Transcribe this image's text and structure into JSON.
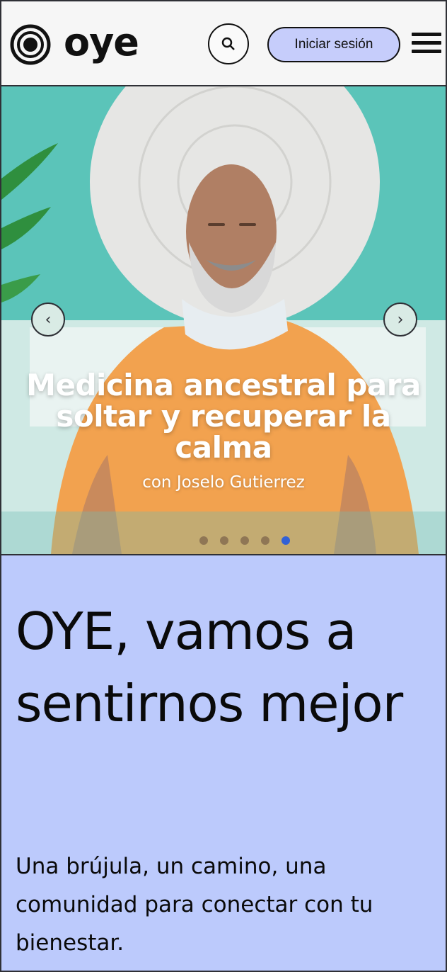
{
  "header": {
    "logo_text": "oye",
    "login_label": "Iniciar sesión",
    "icons": {
      "logo": "concentric-circle-logo",
      "search": "search-icon",
      "menu": "hamburger-menu-icon"
    }
  },
  "hero": {
    "title": "Medicina ancestral para soltar y recuperar la calma",
    "subtitle": "con Joselo Gutierrez",
    "prev_icon": "‹",
    "next_icon": "›",
    "slide_count": 5,
    "active_slide": 5,
    "colors": {
      "background": "#5bc4b9",
      "shirt": "#f2a24f",
      "active_dot": "#3261d6"
    }
  },
  "intro": {
    "headline": "OYE, vamos a sentirnos mejor",
    "tagline": "Una brújula, un camino, una comunidad para conectar con tu bienestar.",
    "background": "#bccafc"
  }
}
